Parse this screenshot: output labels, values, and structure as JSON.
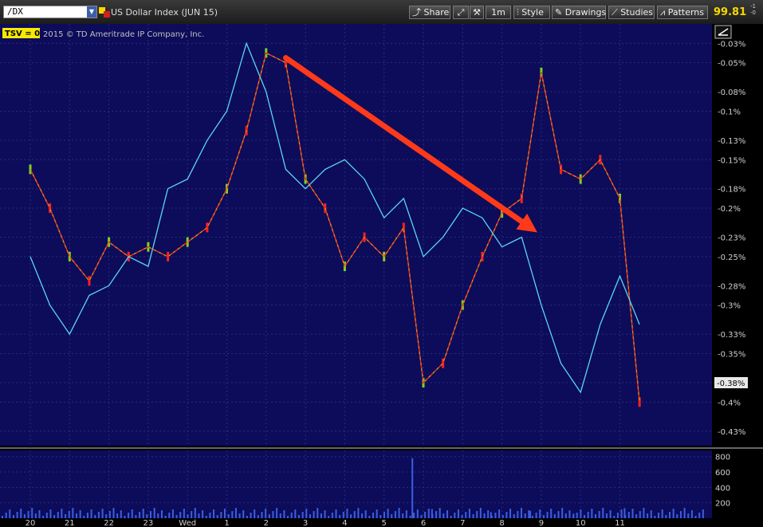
{
  "toolbar": {
    "symbol": "/DX",
    "title": "US Dollar Index (JUN 15)",
    "share": "Share",
    "timeframe": "1m",
    "style": "Style",
    "drawings": "Drawings",
    "studies": "Studies",
    "patterns": "Patterns",
    "price": "99.81",
    "side_top": "-1",
    "side_bottom": "-0"
  },
  "chart_data": {
    "type": "line",
    "study_label": "TSV = 0",
    "copyright": "2015 © TD Ameritrade IP Company, Inc.",
    "current_label": "-0.38%",
    "x_ticks": [
      "20",
      "21",
      "22",
      "23",
      "Wed",
      "1",
      "2",
      "3",
      "4",
      "5",
      "6",
      "7",
      "8",
      "9",
      "10",
      "11"
    ],
    "y_ticks": [
      "-0.03%",
      "-0.05%",
      "-0.08%",
      "-0.1%",
      "-0.13%",
      "-0.15%",
      "-0.18%",
      "-0.2%",
      "-0.23%",
      "-0.25%",
      "-0.28%",
      "-0.3%",
      "-0.33%",
      "-0.35%",
      "-0.38%",
      "-0.4%",
      "-0.43%"
    ],
    "volume_ticks": [
      "800",
      "600",
      "400",
      "200"
    ],
    "ylim": [
      -0.445,
      -0.01
    ],
    "volume_ylim": [
      0,
      880
    ],
    "price_series": [
      [
        "20",
        -0.16
      ],
      [
        "20.5",
        -0.2
      ],
      [
        "21",
        -0.25
      ],
      [
        "21.5",
        -0.275
      ],
      [
        "22",
        -0.235
      ],
      [
        "22.5",
        -0.25
      ],
      [
        "23",
        -0.24
      ],
      [
        "23.5",
        -0.25
      ],
      [
        "Wed",
        -0.235
      ],
      [
        "Wed.5",
        -0.22
      ],
      [
        "1",
        -0.18
      ],
      [
        "1.5",
        -0.12
      ],
      [
        "2",
        -0.04
      ],
      [
        "2.5",
        -0.05
      ],
      [
        "3",
        -0.17
      ],
      [
        "3.5",
        -0.2
      ],
      [
        "4",
        -0.26
      ],
      [
        "4.5",
        -0.23
      ],
      [
        "5",
        -0.25
      ],
      [
        "5.5",
        -0.22
      ],
      [
        "6",
        -0.38
      ],
      [
        "6.5",
        -0.36
      ],
      [
        "7",
        -0.3
      ],
      [
        "7.5",
        -0.25
      ],
      [
        "8",
        -0.205
      ],
      [
        "8.5",
        -0.19
      ],
      [
        "9",
        -0.06
      ],
      [
        "9.5",
        -0.16
      ],
      [
        "10",
        -0.17
      ],
      [
        "10.5",
        -0.15
      ],
      [
        "11",
        -0.19
      ],
      [
        "11.5",
        -0.4
      ]
    ],
    "tsv_series": [
      [
        "20",
        -0.25
      ],
      [
        "20.5",
        -0.3
      ],
      [
        "21",
        -0.33
      ],
      [
        "21.5",
        -0.29
      ],
      [
        "22",
        -0.28
      ],
      [
        "22.5",
        -0.25
      ],
      [
        "23",
        -0.26
      ],
      [
        "23.5",
        -0.18
      ],
      [
        "Wed",
        -0.17
      ],
      [
        "Wed.5",
        -0.13
      ],
      [
        "1",
        -0.1
      ],
      [
        "1.5",
        -0.03
      ],
      [
        "2",
        -0.08
      ],
      [
        "2.5",
        -0.16
      ],
      [
        "3",
        -0.18
      ],
      [
        "3.5",
        -0.16
      ],
      [
        "4",
        -0.15
      ],
      [
        "4.5",
        -0.17
      ],
      [
        "5",
        -0.21
      ],
      [
        "5.5",
        -0.19
      ],
      [
        "6",
        -0.25
      ],
      [
        "6.5",
        -0.23
      ],
      [
        "7",
        -0.2
      ],
      [
        "7.5",
        -0.21
      ],
      [
        "8",
        -0.24
      ],
      [
        "8.5",
        -0.23
      ],
      [
        "9",
        -0.3
      ],
      [
        "9.5",
        -0.36
      ],
      [
        "10",
        -0.39
      ],
      [
        "10.5",
        -0.32
      ],
      [
        "11",
        -0.27
      ],
      [
        "11.5",
        -0.32
      ]
    ],
    "volume_spikes": [
      [
        "5.7",
        780
      ],
      [
        "6.2",
        120
      ],
      [
        "7.7",
        80
      ],
      [
        "8.7",
        95
      ],
      [
        "9.8",
        60
      ],
      [
        "11.1",
        130
      ]
    ],
    "annotation_arrow": {
      "from": [
        "2.5",
        -0.045
      ],
      "to": [
        "8.9",
        -0.225
      ]
    }
  }
}
